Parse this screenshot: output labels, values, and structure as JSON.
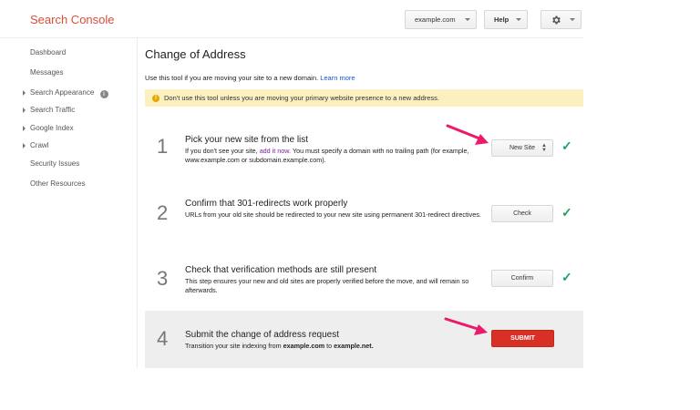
{
  "header": {
    "logo": "Search Console",
    "site_selector": "example.com",
    "help_label": "Help",
    "settings_icon": "gear-icon"
  },
  "sidebar": {
    "items": [
      {
        "label": "Dashboard",
        "expandable": false
      },
      {
        "label": "Messages",
        "expandable": false
      },
      {
        "label": "Search Appearance",
        "expandable": true,
        "info": "i"
      },
      {
        "label": "Search Traffic",
        "expandable": true
      },
      {
        "label": "Google Index",
        "expandable": true
      },
      {
        "label": "Crawl",
        "expandable": true
      },
      {
        "label": "Security Issues",
        "expandable": false
      },
      {
        "label": "Other Resources",
        "expandable": false
      }
    ]
  },
  "main": {
    "title": "Change of Address",
    "intro": "Use this tool if you are moving your site to a new domain.",
    "learn_more": "Learn more",
    "warning_icon": "!",
    "warning": "Don't use this tool unless you are moving your primary website presence to a new address.",
    "steps": [
      {
        "number": "1",
        "title": "Pick your new site from the list",
        "desc_before": "If you don't see your site,",
        "desc_link": "add it now.",
        "desc_after": "You must specify a domain with no trailing path (for example, www.example.com or subdomain.example.com).",
        "button": "New Site",
        "done": true
      },
      {
        "number": "2",
        "title": "Confirm that 301-redirects work properly",
        "desc": "URLs from your old site should be redirected to your new site using permanent 301-redirect directives.",
        "button": "Check",
        "done": true
      },
      {
        "number": "3",
        "title": "Check that verification methods are still present",
        "desc": "This step ensures your new and old sites are properly verified before the move, and will remain so afterwards.",
        "button": "Confirm",
        "done": true
      },
      {
        "number": "4",
        "title": "Submit the change of address request",
        "desc_before": "Transition your site indexing from",
        "old_site": "example.com",
        "desc_mid": "to",
        "new_site": "example.net",
        "desc_after": ".",
        "button": "SUBMIT"
      }
    ]
  },
  "colors": {
    "accent_red": "#dd4b39",
    "submit_red": "#d93025",
    "check_green": "#1ea362",
    "warning_bg": "#fcefc0",
    "annotation_pink": "#ec1a6b"
  }
}
